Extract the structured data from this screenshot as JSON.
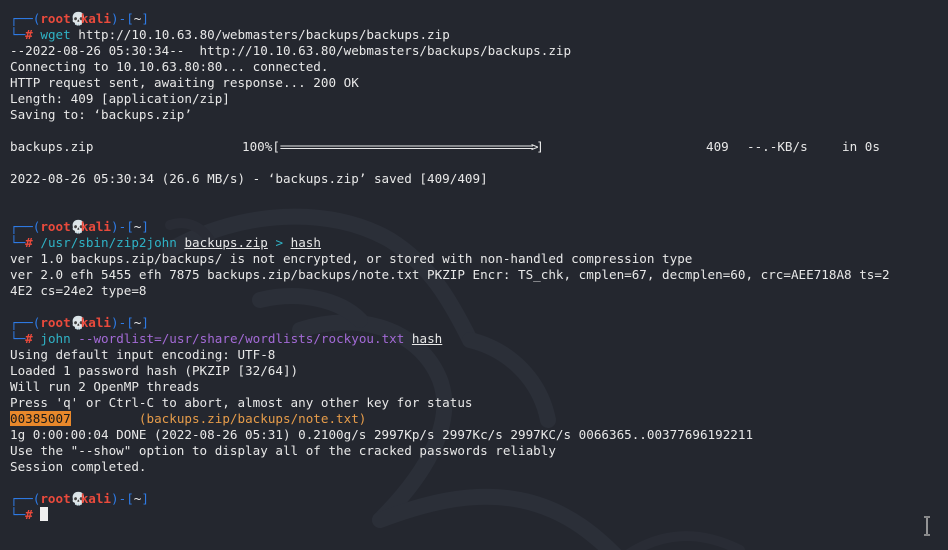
{
  "prompt": {
    "corner_top": "┌──(",
    "corner_bottom": "└─",
    "user": "root",
    "skull": "💀",
    "host": "kali",
    "dir_open": ")-[",
    "dir": "~",
    "dir_close": "]",
    "hash": "#"
  },
  "block1": {
    "cmd": "wget",
    "args": " http://10.10.63.80/webmasters/backups/backups.zip",
    "out1": "--2022-08-26 05:30:34--  http://10.10.63.80/webmasters/backups/backups.zip",
    "out2": "Connecting to 10.10.63.80:80... connected.",
    "out3": "HTTP request sent, awaiting response... 200 OK",
    "out4": "Length: 409 [application/zip]",
    "out5": "Saving to: ‘backups.zip’",
    "progress_file": "backups.zip",
    "progress_pct": "100%[",
    "progress_bar": "================================================>",
    "progress_end": "]",
    "progress_size": "409",
    "progress_rate": "--.-KB/s",
    "progress_time": "in 0s",
    "progress_fraction": 1.0,
    "saved": "2022-08-26 05:30:34 (26.6 MB/s) - ‘backups.zip’ saved [409/409]"
  },
  "block2": {
    "cmd": "/usr/sbin/zip2john",
    "arg1": "backups.zip",
    "redirect": ">",
    "arg2": "hash",
    "out1": "ver 1.0 backups.zip/backups/ is not encrypted, or stored with non-handled compression type",
    "out2": "ver 2.0 efh 5455 efh 7875 backups.zip/backups/note.txt PKZIP Encr: TS_chk, cmplen=67, decmplen=60, crc=AEE718A8 ts=2",
    "out3": "4E2 cs=24e2 type=8"
  },
  "block3": {
    "cmd": "john",
    "flag": "--wordlist=/usr/share/wordlists/rockyou.txt",
    "arg": "hash",
    "out1": "Using default input encoding: UTF-8",
    "out2": "Loaded 1 password hash (PKZIP [32/64])",
    "out3": "Will run 2 OpenMP threads",
    "out4": "Press 'q' or Ctrl-C to abort, almost any other key for status",
    "password": "00385007",
    "password_file": "(backups.zip/backups/note.txt)",
    "out6": "1g 0:00:00:04 DONE (2022-08-26 05:31) 0.2100g/s 2997Kp/s 2997Kc/s 2997KC/s 0066365..00377696192211",
    "out7": "Use the \"--show\" option to display all of the cracked passwords reliably",
    "out8": "Session completed."
  },
  "colors": {
    "background": "#24272f",
    "prompt_frame": "#2e7be6",
    "user_host": "#ea4a3c",
    "command": "#2fb3c6",
    "option": "#a36ad6",
    "highlight": "#e8882b",
    "filename": "#e69c4a",
    "text": "#e8e8e8"
  },
  "icons": {
    "skull": "skull-icon",
    "cursor": "text-cursor-icon",
    "ibeam": "ibeam-pointer-icon",
    "watermark": "kali-dragon-watermark"
  }
}
